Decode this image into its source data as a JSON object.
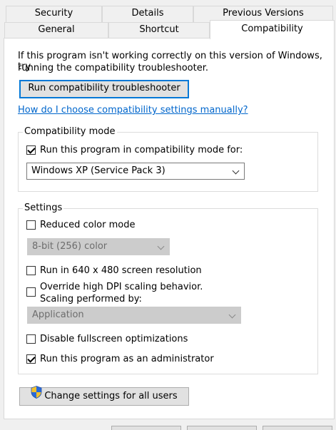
{
  "tabs": {
    "security": "Security",
    "details": "Details",
    "previous_versions": "Previous Versions",
    "general": "General",
    "shortcut": "Shortcut",
    "compatibility": "Compatibility"
  },
  "intro_text_line1": "If this program isn't working correctly on this version of Windows, try",
  "intro_text_line2": "running the compatibility troubleshooter.",
  "troubleshooter_button": "Run compatibility troubleshooter",
  "manual_link": "How do I choose compatibility settings manually?",
  "compat_mode": {
    "title": "Compatibility mode",
    "checkbox_label": "Run this program in compatibility mode for:",
    "checked": true,
    "selected_os": "Windows XP (Service Pack 3)"
  },
  "settings": {
    "title": "Settings",
    "reduced_color_label": "Reduced color mode",
    "reduced_color_checked": false,
    "color_option": "8-bit (256) color",
    "resolution_label": "Run in 640 x 480 screen resolution",
    "resolution_checked": false,
    "dpi_label_line1": "Override high DPI scaling behavior.",
    "dpi_label_line2": "Scaling performed by:",
    "dpi_checked": false,
    "dpi_option": "Application",
    "fullscreen_label": "Disable fullscreen optimizations",
    "fullscreen_checked": false,
    "admin_label": "Run this program as an administrator",
    "admin_checked": true
  },
  "change_all_users_button": "Change settings for all users",
  "colors": {
    "link": "#0066cc",
    "focus_border": "#0078d7",
    "shield_blue": "#2a6ad8",
    "shield_yellow": "#f2c12e"
  }
}
